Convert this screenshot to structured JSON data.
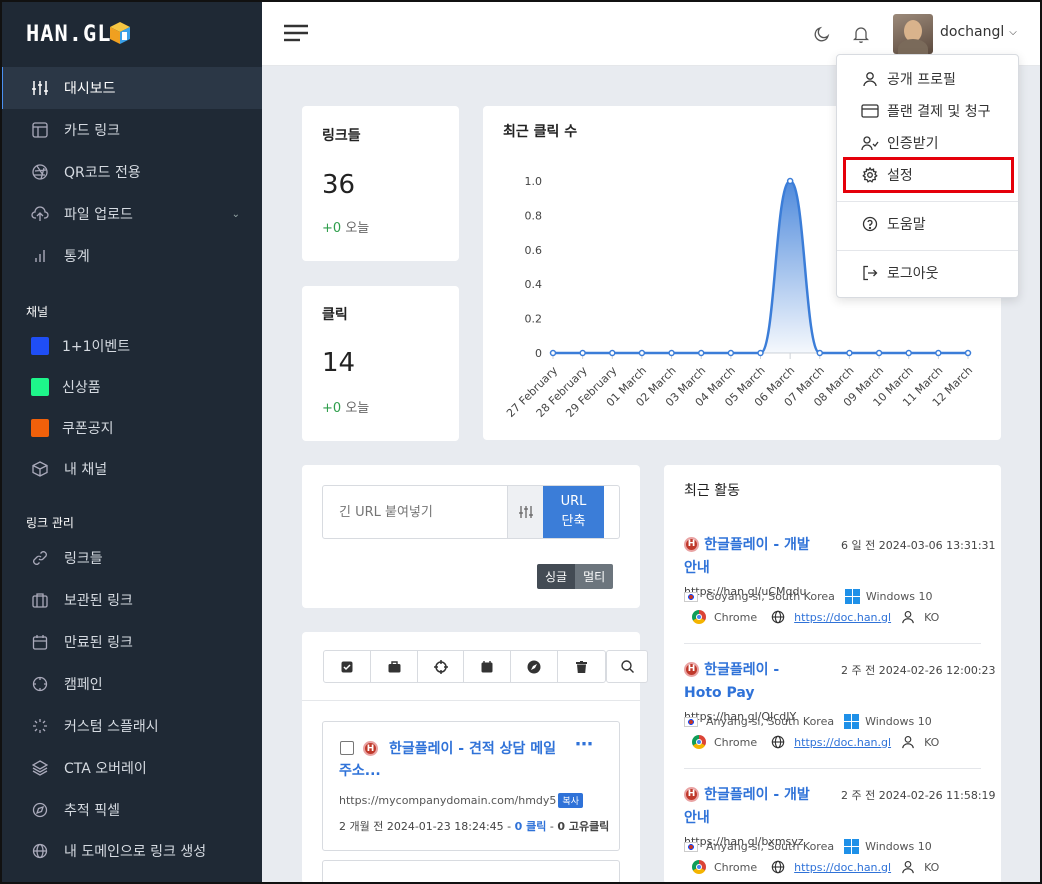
{
  "brand": {
    "logo_text": "HAN.GL"
  },
  "sidebar": {
    "items": [
      {
        "label": "대시보드",
        "icon": "sliders-icon"
      },
      {
        "label": "카드 링크",
        "icon": "layout-icon"
      },
      {
        "label": "QR코드 전용",
        "icon": "aperture-icon"
      },
      {
        "label": "파일 업로드",
        "icon": "upload-cloud-icon"
      },
      {
        "label": "통계",
        "icon": "bar-chart-icon"
      }
    ],
    "channels_heading": "채널",
    "channels": [
      {
        "label": "1+1이벤트",
        "color": "#1f4ef5"
      },
      {
        "label": "신상품",
        "color": "#1ef58a"
      },
      {
        "label": "쿠폰공지",
        "color": "#f0600a"
      },
      {
        "label": "내 채널",
        "icon": "box-icon"
      }
    ],
    "links_heading": "링크 관리",
    "links": [
      {
        "label": "링크들",
        "icon": "link-icon"
      },
      {
        "label": "보관된 링크",
        "icon": "briefcase-icon"
      },
      {
        "label": "만료된 링크",
        "icon": "calendar-icon"
      },
      {
        "label": "캠페인",
        "icon": "crosshair-icon"
      },
      {
        "label": "커스텀 스플래시",
        "icon": "loader-icon"
      },
      {
        "label": "CTA 오버레이",
        "icon": "layers-icon"
      },
      {
        "label": "추적 픽셀",
        "icon": "compass-icon"
      },
      {
        "label": "내 도메인으로 링크 생성",
        "icon": "globe-icon"
      }
    ]
  },
  "header": {
    "username": "dochangl"
  },
  "user_menu": {
    "items": [
      "공개 프로필",
      "플랜 결제 및 청구",
      "인증받기",
      "설정",
      "도움말",
      "로그아웃"
    ],
    "highlighted": "설정"
  },
  "stats": {
    "links": {
      "title": "링크들",
      "value": "36",
      "delta": "+0",
      "delta_label": "오늘"
    },
    "clicks": {
      "title": "클릭",
      "value": "14",
      "delta": "+0",
      "delta_label": "오늘"
    }
  },
  "chart_data": {
    "type": "area",
    "title": "최근 클릭 수",
    "categories": [
      "27 February",
      "28 February",
      "29 February",
      "01 March",
      "02 March",
      "03 March",
      "04 March",
      "05 March",
      "06 March",
      "07 March",
      "08 March",
      "09 March",
      "10 March",
      "11 March",
      "12 March"
    ],
    "values": [
      0,
      0,
      0,
      0,
      0,
      0,
      0,
      0,
      1,
      0,
      0,
      0,
      0,
      0,
      0
    ],
    "ylim": [
      0,
      1
    ],
    "yticks": [
      "0",
      "0.2",
      "0.4",
      "0.6",
      "0.8",
      "1.0"
    ],
    "color": "#3b7dd8"
  },
  "shortener": {
    "placeholder": "긴 URL 붙여넣기",
    "button": "URL\n단축",
    "mode_single": "싱글",
    "mode_multi": "멀티"
  },
  "link_item": {
    "title": "한글플레이 - 견적 상담 메일 주소...",
    "url": "https://mycompanydomain.com/hmdy5",
    "copy_label": "복사",
    "meta_prefix": "2 개월 전 2024-01-23 18:24:45 - ",
    "clicks": "0 클릭",
    "unique": "0 고유클릭"
  },
  "activity": {
    "title": "최근 활동",
    "entries": [
      {
        "title": "한글플레이 - 개발안내",
        "when": "6 일 전 2024-03-06 13:31:31",
        "short": "https://han.gl/uCMqdu",
        "location": "Goyang-si, South Korea",
        "os": "Windows 10",
        "browser": "Chrome",
        "referrer": "https://doc.han.gl",
        "lang": "KO"
      },
      {
        "title": "한글플레이 - Hoto Pay",
        "when": "2 주 전 2024-02-26 12:00:23",
        "short": "https://han.gl/QIcdJY",
        "location": "Anyang-si, South Korea",
        "os": "Windows 10",
        "browser": "Chrome",
        "referrer": "https://doc.han.gl",
        "lang": "KO"
      },
      {
        "title": "한글플레이 - 개발안내",
        "when": "2 주 전 2024-02-26 11:58:19",
        "short": "https://han.gl/bxmsyz",
        "location": "Anyang-si, South Korea",
        "os": "Windows 10",
        "browser": "Chrome",
        "referrer": "https://doc.han.gl",
        "lang": "KO"
      }
    ]
  }
}
